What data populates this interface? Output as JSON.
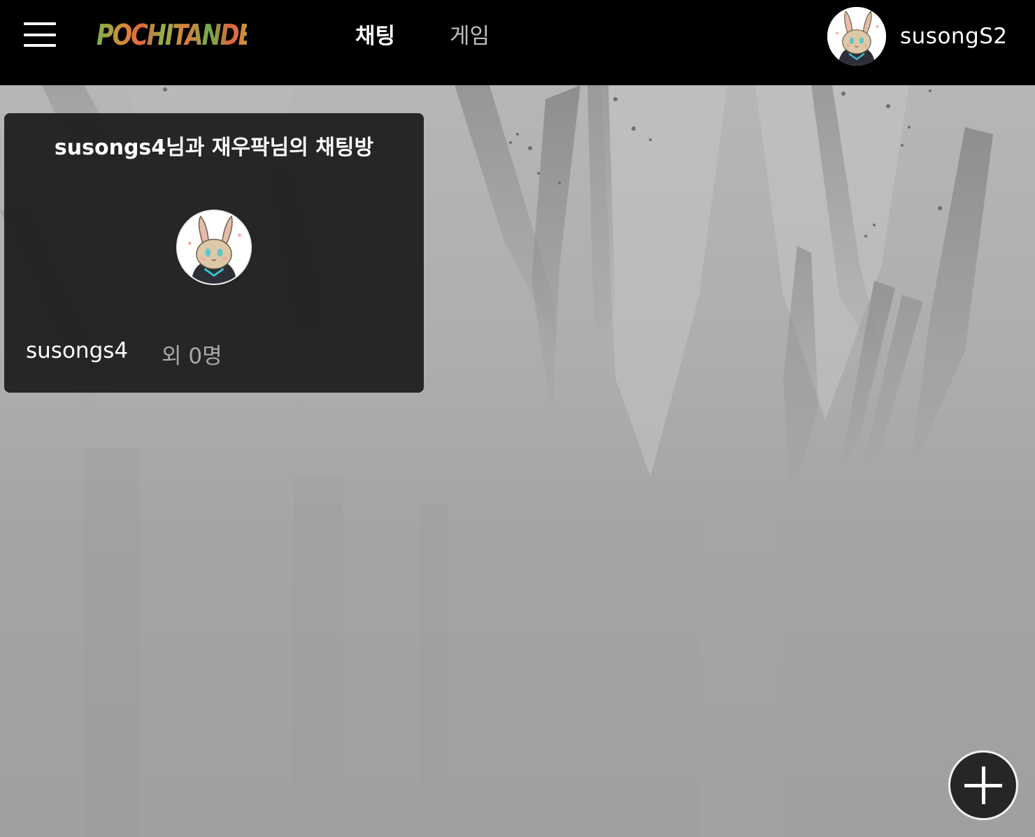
{
  "header": {
    "menu_icon": "hamburger-menu-icon",
    "logo_text": "POCHITANDENCE",
    "tabs": [
      {
        "label": "채팅",
        "active": true
      },
      {
        "label": "게임",
        "active": false
      }
    ],
    "user": {
      "name": "susongS2",
      "avatar_icon": "rabbit-character-avatar"
    }
  },
  "room_list": [
    {
      "title": "susongs4님과 재우팍님의 채팅방",
      "avatar_icon": "rabbit-character-avatar",
      "owner": "susongs4",
      "others": "외 0명"
    }
  ],
  "fab": {
    "icon": "plus-icon"
  },
  "colors": {
    "topbar": "#000000",
    "card": "#212121",
    "text_primary": "#ffffff",
    "text_secondary": "#a9a9a9",
    "background": "#a3a3a3"
  }
}
